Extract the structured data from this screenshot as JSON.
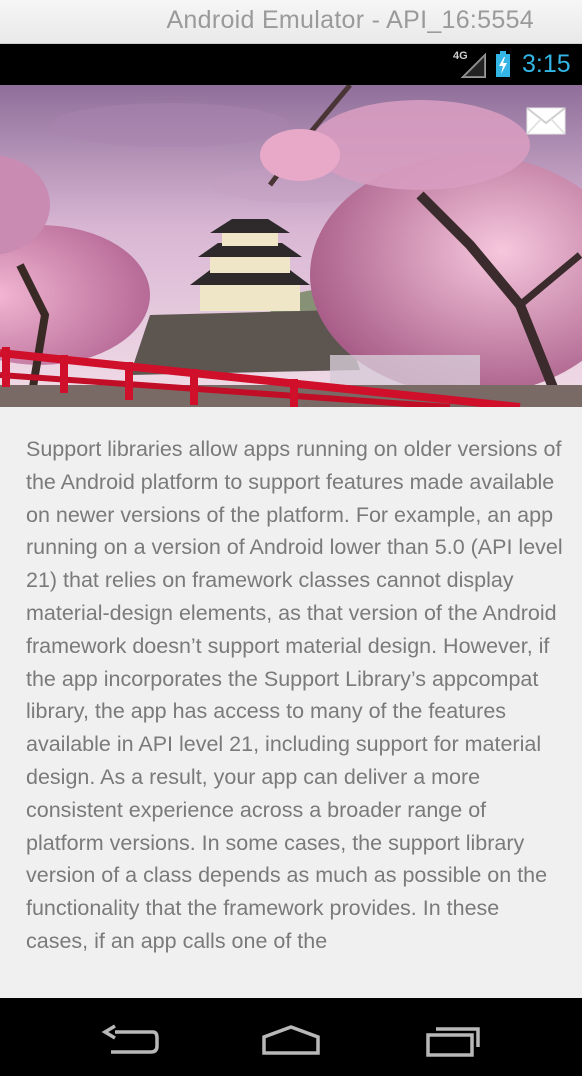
{
  "window": {
    "title": "Android Emulator - API_16:5554"
  },
  "status_bar": {
    "network": "4G",
    "time": "3:15",
    "clock_color": "#33b5e5"
  },
  "header": {
    "image_icon": "cherry-blossom-castle-image",
    "mail_icon": "mail-icon"
  },
  "content": {
    "text": "Support libraries allow apps running on older versions of the Android platform to support features made available on newer versions of the platform. For example, an app running on a version of Android lower than 5.0 (API level 21) that relies on framework classes cannot display material-design elements, as that version of the Android framework doesn’t support material design. However, if the app incorporates the Support Library’s appcompat library, the app has access to many of the features available in API level 21, including support for material design. As a result, your app can deliver a more consistent experience across a broader range of platform versions.  In some cases, the support library version of a class depends as much as possible on the functionality that the framework provides. In these cases, if an app calls one of the"
  },
  "nav_bar": {
    "back_icon": "back-icon",
    "home_icon": "home-icon",
    "recents_icon": "recents-icon"
  }
}
